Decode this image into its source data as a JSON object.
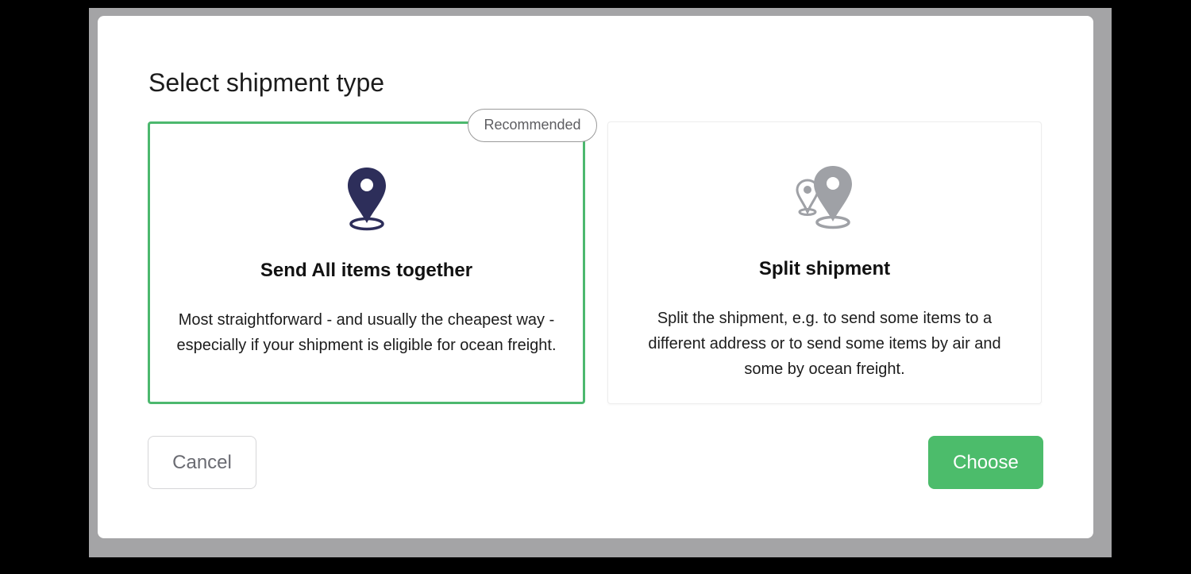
{
  "dialog": {
    "title": "Select shipment type"
  },
  "options": [
    {
      "title": "Send All items together",
      "description": "Most straightforward - and usually the cheapest way - especially if your shipment is eligible for ocean freight.",
      "badge": "Recommended",
      "icon": "location-pin-icon",
      "selected": true
    },
    {
      "title": "Split shipment",
      "description": "Split the shipment, e.g. to send some items to a different address or to send some items by air and some by ocean freight.",
      "icon": "multiple-location-pins-icon",
      "selected": false
    }
  ],
  "buttons": {
    "cancel": "Cancel",
    "choose": "Choose"
  },
  "colors": {
    "accent_green": "#4cbc6b",
    "selected_border": "#4cb86e",
    "pin_selected": "#2d2e5a",
    "pin_unselected": "#9fa1a6"
  }
}
